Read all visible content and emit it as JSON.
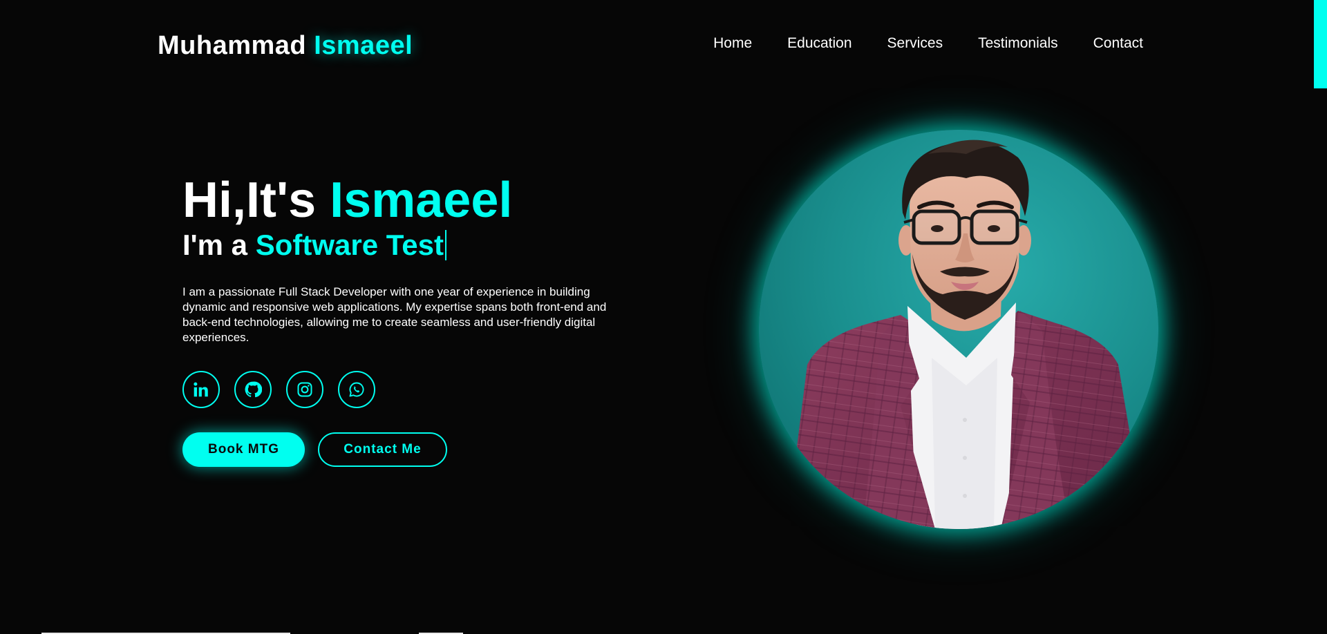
{
  "logo": {
    "first": "Muhammad",
    "second": "Ismaeel"
  },
  "nav": {
    "items": [
      {
        "label": "Home"
      },
      {
        "label": "Education"
      },
      {
        "label": "Services"
      },
      {
        "label": "Testimonials"
      },
      {
        "label": "Contact"
      }
    ]
  },
  "hero": {
    "greeting_prefix": "Hi,It's",
    "greeting_name": "Ismaeel",
    "role_prefix": "I'm a",
    "role_typed": "Software Test",
    "description": "I am a passionate Full Stack Developer with one year of experience in building dynamic and responsive web applications. My expertise spans both front-end and back-end technologies, allowing me to create seamless and user-friendly digital experiences."
  },
  "socials": [
    {
      "icon": "linkedin-icon"
    },
    {
      "icon": "github-icon"
    },
    {
      "icon": "instagram-icon"
    },
    {
      "icon": "whatsapp-icon"
    }
  ],
  "buttons": {
    "book_label": "Book MTG",
    "contact_label": "Contact Me"
  },
  "profile": {
    "icon": "profile-photo"
  },
  "colors": {
    "accent": "#00fff0",
    "background": "#060606",
    "text": "#ffffff"
  }
}
